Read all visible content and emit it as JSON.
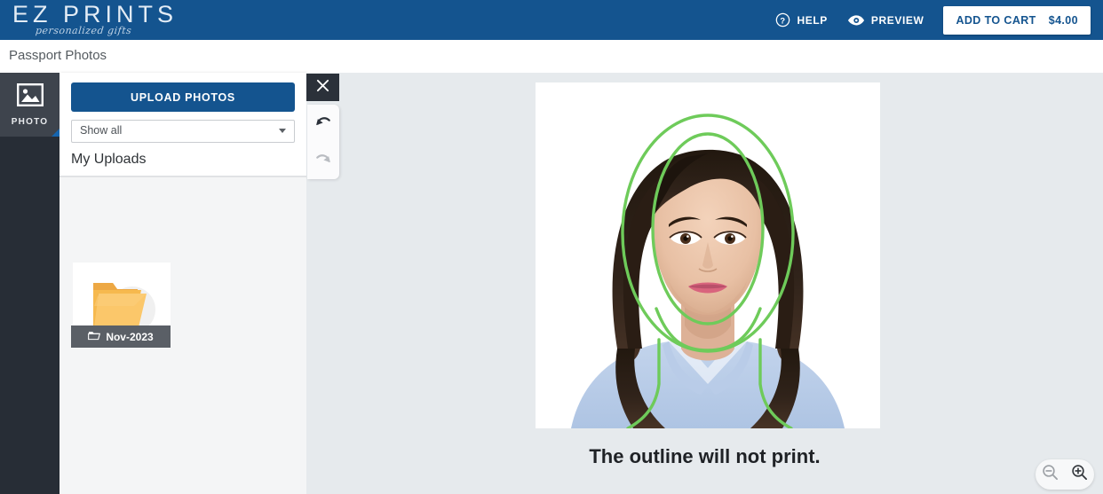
{
  "header": {
    "logo_main": "EZ PRINTS",
    "logo_sub": "personalized gifts",
    "help_label": "HELP",
    "preview_label": "PREVIEW",
    "cart_label": "ADD TO CART",
    "cart_price": "$4.00",
    "bg_color": "#14548f",
    "help_icon": "question-circle-icon",
    "preview_icon": "eye-icon"
  },
  "breadcrumb": {
    "title": "Passport Photos"
  },
  "rail": {
    "tabs": [
      {
        "label": "PHOTO",
        "icon": "image-icon",
        "active": true
      }
    ]
  },
  "panel": {
    "upload_button": "UPLOAD PHOTOS",
    "filter_select": {
      "value": "Show all",
      "options": [
        "Show all"
      ]
    },
    "uploads_heading": "My Uploads",
    "items": [
      {
        "label": "Nov-2023",
        "icon": "folder-open-icon",
        "thumb": "folder-thumbnail"
      }
    ]
  },
  "editor": {
    "close_icon": "close-icon",
    "undo_icon": "undo-icon",
    "redo_icon": "redo-icon",
    "zoom_out_icon": "zoom-out-icon",
    "zoom_in_icon": "zoom-in-icon"
  },
  "canvas": {
    "caption": "The outline will not print.",
    "outline_color": "#6ecb5a",
    "background_color": "#e6eaed",
    "photo_alt": "passport-portrait-photo"
  }
}
